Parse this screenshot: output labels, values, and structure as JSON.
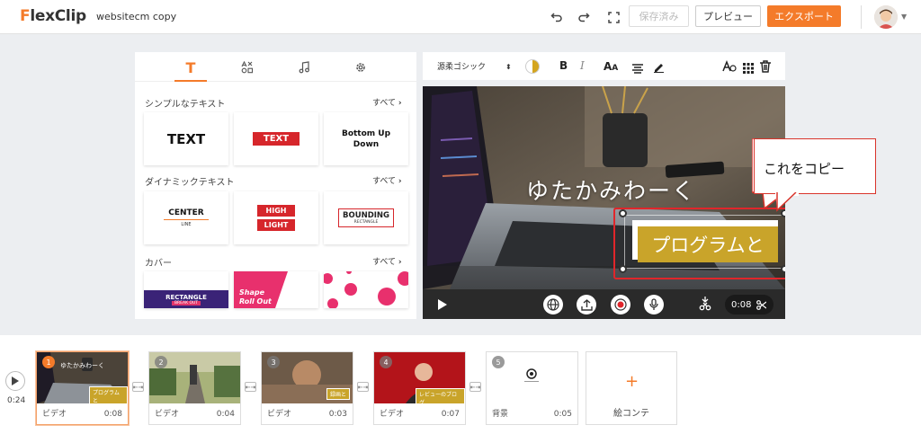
{
  "app": {
    "logo_prefix": "F",
    "logo_main": "lexClip",
    "project_name": "websitecm copy",
    "accent": "#f47b2a"
  },
  "toolbar": {
    "undo_icon": "undo-icon",
    "redo_icon": "redo-icon",
    "fullscreen_icon": "fullscreen-icon",
    "saved_label": "保存済み",
    "preview_label": "プレビュー",
    "export_label": "エクスポート"
  },
  "left_panel": {
    "tabs": [
      "text-tab",
      "elements-tab",
      "music-tab",
      "settings-tab"
    ],
    "sections": [
      {
        "title": "シンプルなテキスト",
        "all": "すべて"
      },
      {
        "title": "ダイナミックテキスト",
        "all": "すべて"
      },
      {
        "title": "カバー",
        "all": "すべて"
      }
    ],
    "simple_cards": [
      "TEXT",
      "TEXT",
      "Bottom Up\nDown"
    ],
    "dynamic_cards": {
      "center": "CENTER",
      "center_sub": "LINE",
      "high": "HIGH",
      "light": "LIGHT",
      "bounding": "BOUNDING",
      "bounding_sub": "RECTANGLE"
    },
    "cover_cards": {
      "rectangle": "RECTANGLE",
      "rectangle_sub": "BREAK OUT",
      "shape": "Shape",
      "rollout": "Roll Out"
    }
  },
  "editor": {
    "font_name": "源柔ゴシック",
    "overlay_title": "ゆたかみわーく",
    "overlay_box_text": "プログラムと",
    "callout": "これをコピー",
    "time": "0:08"
  },
  "timeline": {
    "total_time": "0:24",
    "clips": [
      {
        "num": "1",
        "type": "ビデオ",
        "duration": "0:08",
        "badge": "プログラムと",
        "title": "ゆたかみわーく"
      },
      {
        "num": "2",
        "type": "ビデオ",
        "duration": "0:04",
        "badge": "",
        "title": ""
      },
      {
        "num": "3",
        "type": "ビデオ",
        "duration": "0:03",
        "badge": "録画と",
        "title": ""
      },
      {
        "num": "4",
        "type": "ビデオ",
        "duration": "0:07",
        "badge": "レビューのブログ",
        "title": ""
      },
      {
        "num": "5",
        "type": "背景",
        "duration": "0:05",
        "badge": "",
        "title": ""
      }
    ],
    "storyboard_label": "絵コンテ"
  }
}
